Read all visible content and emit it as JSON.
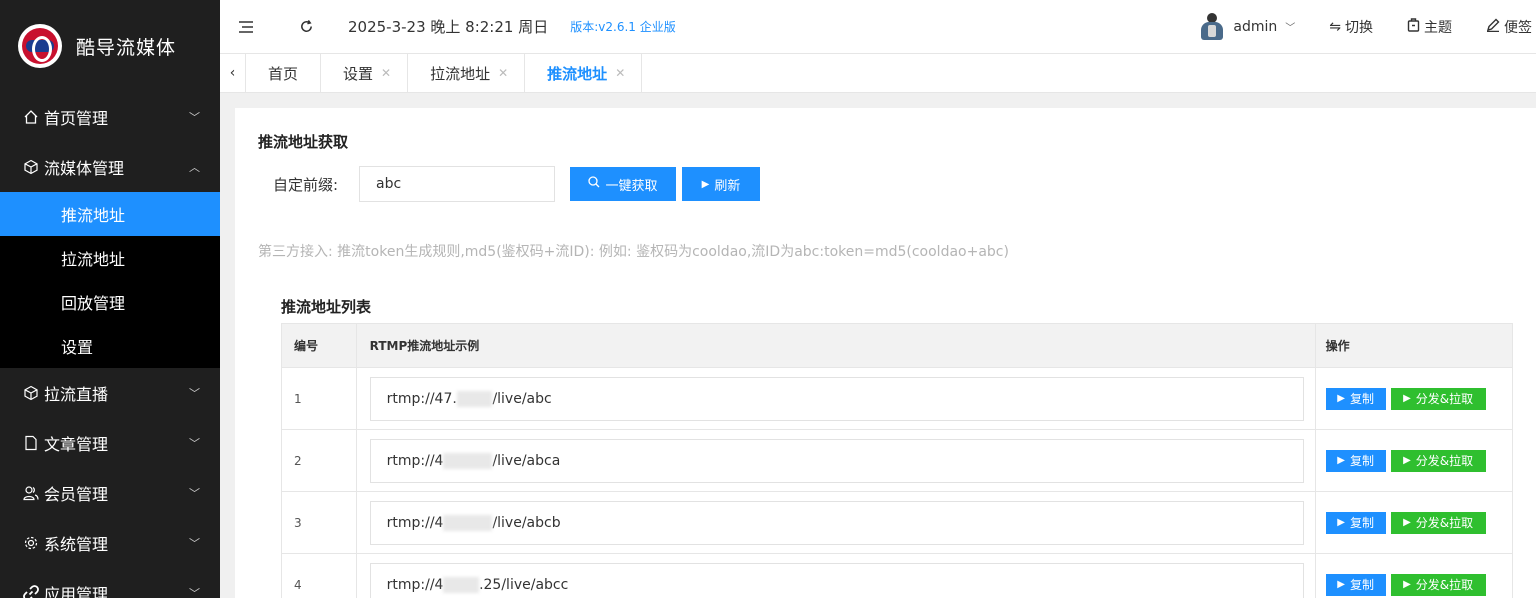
{
  "app": {
    "title": "酷导流媒体"
  },
  "sidebar": {
    "menus": [
      {
        "label": "首页管理",
        "icon": "home-icon",
        "expanded": false
      },
      {
        "label": "流媒体管理",
        "icon": "cube-icon",
        "expanded": true,
        "children": [
          {
            "label": "推流地址",
            "active": true
          },
          {
            "label": "拉流地址",
            "active": false
          },
          {
            "label": "回放管理",
            "active": false
          },
          {
            "label": "设置",
            "active": false
          }
        ]
      },
      {
        "label": "拉流直播",
        "icon": "cube-icon",
        "expanded": false
      },
      {
        "label": "文章管理",
        "icon": "document-icon",
        "expanded": false
      },
      {
        "label": "会员管理",
        "icon": "users-icon",
        "expanded": false
      },
      {
        "label": "系统管理",
        "icon": "gear-icon",
        "expanded": false
      },
      {
        "label": "应用管理",
        "icon": "link-icon",
        "expanded": false
      }
    ]
  },
  "header": {
    "datetime": "2025-3-23 晚上 8:2:21 周日",
    "version": "版本:v2.6.1 企业版",
    "user": "admin",
    "actions": [
      {
        "label": "切换",
        "icon": "switch-icon"
      },
      {
        "label": "主题",
        "icon": "theme-icon"
      },
      {
        "label": "便签",
        "icon": "pen-icon"
      }
    ]
  },
  "tabs": [
    {
      "label": "首页",
      "closable": false,
      "active": false
    },
    {
      "label": "设置",
      "closable": true,
      "active": false
    },
    {
      "label": "拉流地址",
      "closable": true,
      "active": false
    },
    {
      "label": "推流地址",
      "closable": true,
      "active": true
    }
  ],
  "fetch_section": {
    "title": "推流地址获取",
    "prefix_label": "自定前缀:",
    "prefix_value": "abc",
    "get_button": "一键获取",
    "refresh_button": "刷新",
    "hint": "第三方接入:  推流token生成规则,md5(鉴权码+流ID):  例如:  鉴权码为cooldao,流ID为abc:token=md5(cooldao+abc)"
  },
  "list_section": {
    "title": "推流地址列表",
    "columns": [
      "编号",
      "RTMP推流地址示例",
      "操作"
    ],
    "rows": [
      {
        "num": "1",
        "url_prefix": "rtmp://47.",
        "url_masked": "1 1 6",
        "url_suffix": "/live/abc"
      },
      {
        "num": "2",
        "url_prefix": "rtmp://4",
        "url_masked": "7 1 1 6",
        "url_suffix": "/live/abca"
      },
      {
        "num": "3",
        "url_prefix": "rtmp://4",
        "url_masked": "7 1 1 6",
        "url_suffix": "/live/abcb"
      },
      {
        "num": "4",
        "url_prefix": "rtmp://4",
        "url_masked": "7 1 1",
        "url_suffix": ".25/live/abcc"
      }
    ],
    "copy_button": "复制",
    "distribute_button": "分发&拉取"
  },
  "colors": {
    "sidebar_bg": "#1f1f1f",
    "submenu_bg": "#000000",
    "accent": "#1e90ff",
    "green": "#2fbf2f",
    "hint": "#b5b5b5"
  }
}
